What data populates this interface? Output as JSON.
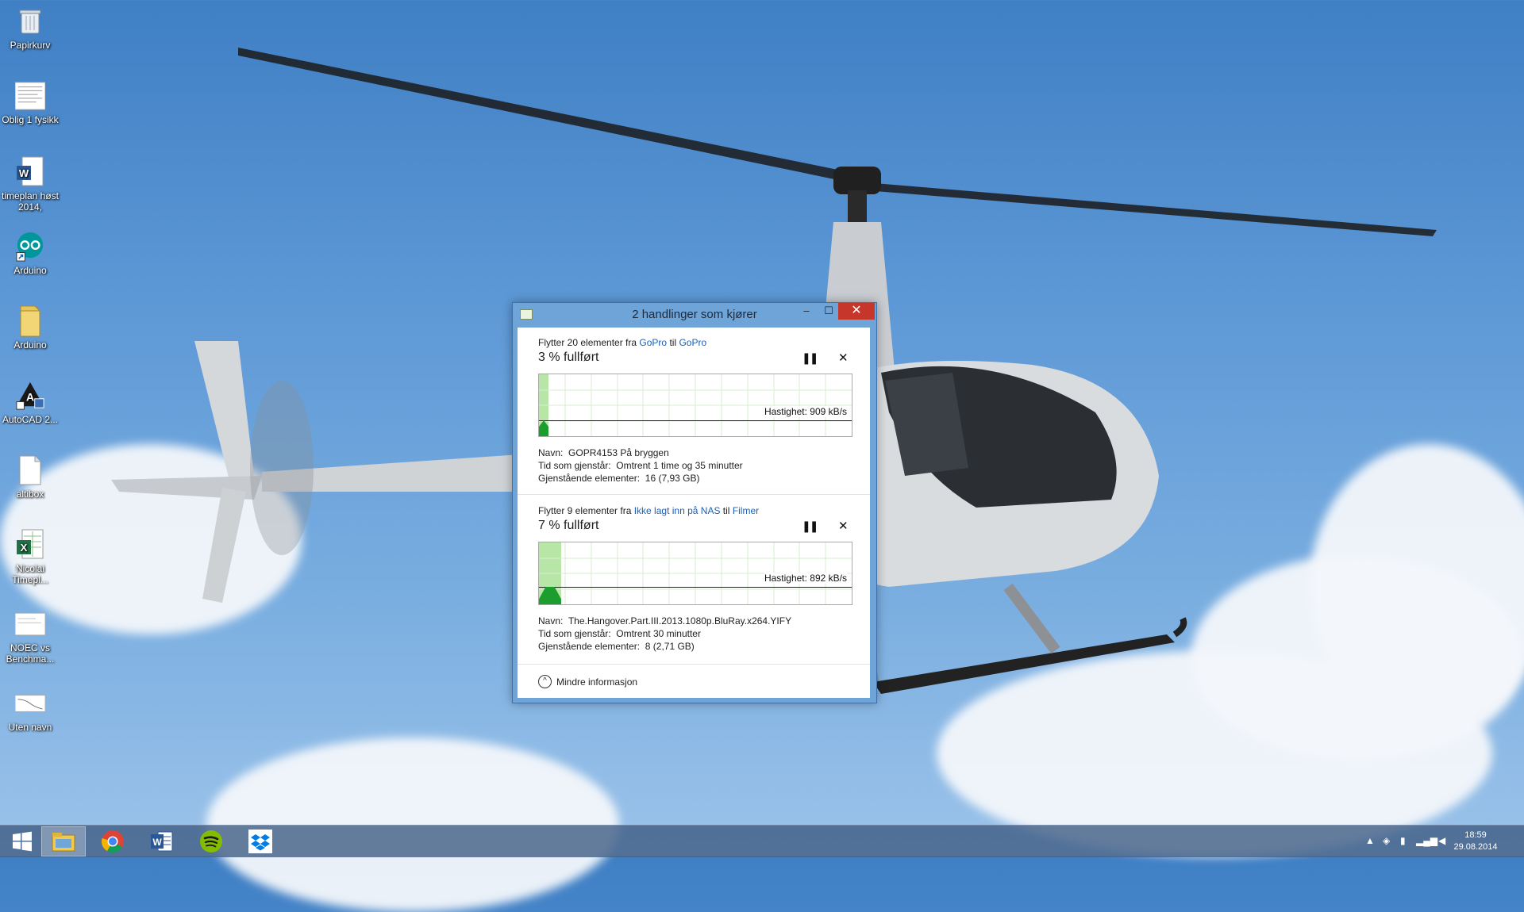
{
  "desktop": {
    "icons": [
      {
        "label": "Papirkurv",
        "icon": "recycle-bin-icon"
      },
      {
        "label": "Oblig 1 fysikk",
        "icon": "document-icon"
      },
      {
        "label": "timeplan høst 2014,",
        "icon": "word-document-icon"
      },
      {
        "label": "Arduino",
        "icon": "arduino-icon"
      },
      {
        "label": "Arduino",
        "icon": "folder-icon"
      },
      {
        "label": "AutoCAD 2...",
        "icon": "autocad-icon"
      },
      {
        "label": "altibox",
        "icon": "text-file-icon"
      },
      {
        "label": "Nicolai Timepl...",
        "icon": "excel-document-icon"
      },
      {
        "label": "NOEC vs Benchma...",
        "icon": "document-thumbnail-icon"
      },
      {
        "label": "Uten navn",
        "icon": "image-thumbnail-icon"
      }
    ]
  },
  "dialog": {
    "title": "2 handlinger som kjører",
    "minimize": "–",
    "maximize": "☐",
    "close": "✕",
    "operations": [
      {
        "prefix": "Flytter 20 elementer fra",
        "from": "GoPro",
        "mid": "til",
        "to": "GoPro",
        "percent_text": "3 % fullført",
        "progress": 0.03,
        "speed_text": "Hastighet: 909 kB/s",
        "name_label": "Navn:",
        "name_value": "GOPR4153 På bryggen",
        "time_label": "Tid som gjenstår:",
        "time_value": "Omtrent 1 time og 35 minutter",
        "remaining_label": "Gjenstående elementer:",
        "remaining_value": "16 (7,93 GB)"
      },
      {
        "prefix": "Flytter 9 elementer fra",
        "from": "Ikke lagt inn på NAS",
        "mid": "til",
        "to": "Filmer",
        "percent_text": "7 % fullført",
        "progress": 0.07,
        "speed_text": "Hastighet: 892 kB/s",
        "name_label": "Navn:",
        "name_value": "The.Hangover.Part.III.2013.1080p.BluRay.x264.YIFY",
        "time_label": "Tid som gjenstår:",
        "time_value": "Omtrent 30 minutter",
        "remaining_label": "Gjenstående elementer:",
        "remaining_value": "8 (2,71 GB)"
      }
    ],
    "pause_symbol": "❚❚",
    "cancel_symbol": "✕",
    "less_info": "Mindre informasjon",
    "less_info_symbol": "^"
  },
  "taskbar": {
    "apps": [
      "windows-start-icon",
      "file-explorer-icon",
      "chrome-icon",
      "word-icon",
      "spotify-icon",
      "dropbox-icon"
    ],
    "time": "18:59",
    "date": "29.08.2014"
  },
  "colors": {
    "accent_link": "#1e5fb3",
    "progress_fill": "#b8e6a6",
    "progress_bar": "#1c9e2f",
    "close_button": "#c7362b"
  }
}
